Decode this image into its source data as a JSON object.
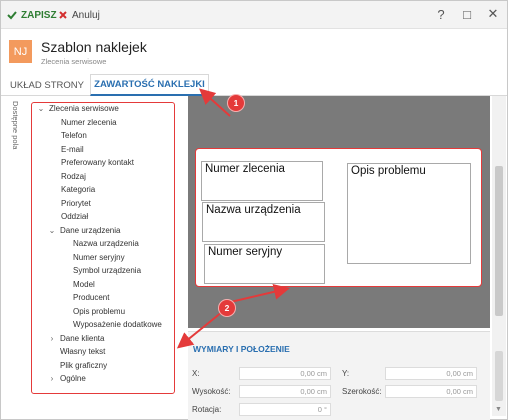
{
  "toolbar": {
    "save_label": "ZAPISZ",
    "cancel_label": "Anuluj",
    "help_icon": "?",
    "maximize_icon": "□",
    "close_icon": "✕",
    "save_color": "#2e7d32",
    "cancel_color": "#d32f2f"
  },
  "header": {
    "badge": "NJ",
    "badge_color": "#f39a5d",
    "title": "Szablon naklejek",
    "subtitle": "Zlecenia serwisowe"
  },
  "tabs": [
    {
      "label": "UKŁAD STRONY",
      "active": false
    },
    {
      "label": "ZAWARTOŚĆ NAKLEJKI",
      "active": true
    }
  ],
  "side_label": "Dostępne pola",
  "tree": {
    "root": "Zlecenia serwisowe",
    "root_items": [
      "Numer zlecenia",
      "Telefon",
      "E-mail",
      "Preferowany kontakt",
      "Rodzaj",
      "Kategoria",
      "Priorytet",
      "Oddział"
    ],
    "group": "Dane urządzenia",
    "group_items": [
      "Nazwa urządzenia",
      "Numer seryjny",
      "Symbol urządzenia",
      "Model",
      "Producent",
      "Opis problemu",
      "Wyposażenie dodatkowe"
    ],
    "tail": [
      {
        "label": "Dane klienta",
        "chevron": "collapsed"
      },
      {
        "label": "Własny tekst",
        "chevron": "none"
      },
      {
        "label": "Plik graficzny",
        "chevron": "none"
      },
      {
        "label": "Ogólne",
        "chevron": "collapsed"
      }
    ]
  },
  "canvas": {
    "fields": [
      "Numer zlecenia",
      "Nazwa urządzenia",
      "Numer seryjny",
      "Opis problemu"
    ]
  },
  "dimensions": {
    "title": "WYMIARY I POŁOŻENIE",
    "x_label": "X:",
    "x_value": "0,00 cm",
    "y_label": "Y:",
    "y_value": "0,00 cm",
    "height_label": "Wysokość:",
    "height_value": "0,00 cm",
    "width_label": "Szerokość:",
    "width_value": "0,00 cm",
    "rotation_label": "Rotacja:",
    "rotation_value": "0 °"
  },
  "annotations": {
    "badge_1": "1",
    "badge_2": "2",
    "color": "#e43a3a"
  }
}
